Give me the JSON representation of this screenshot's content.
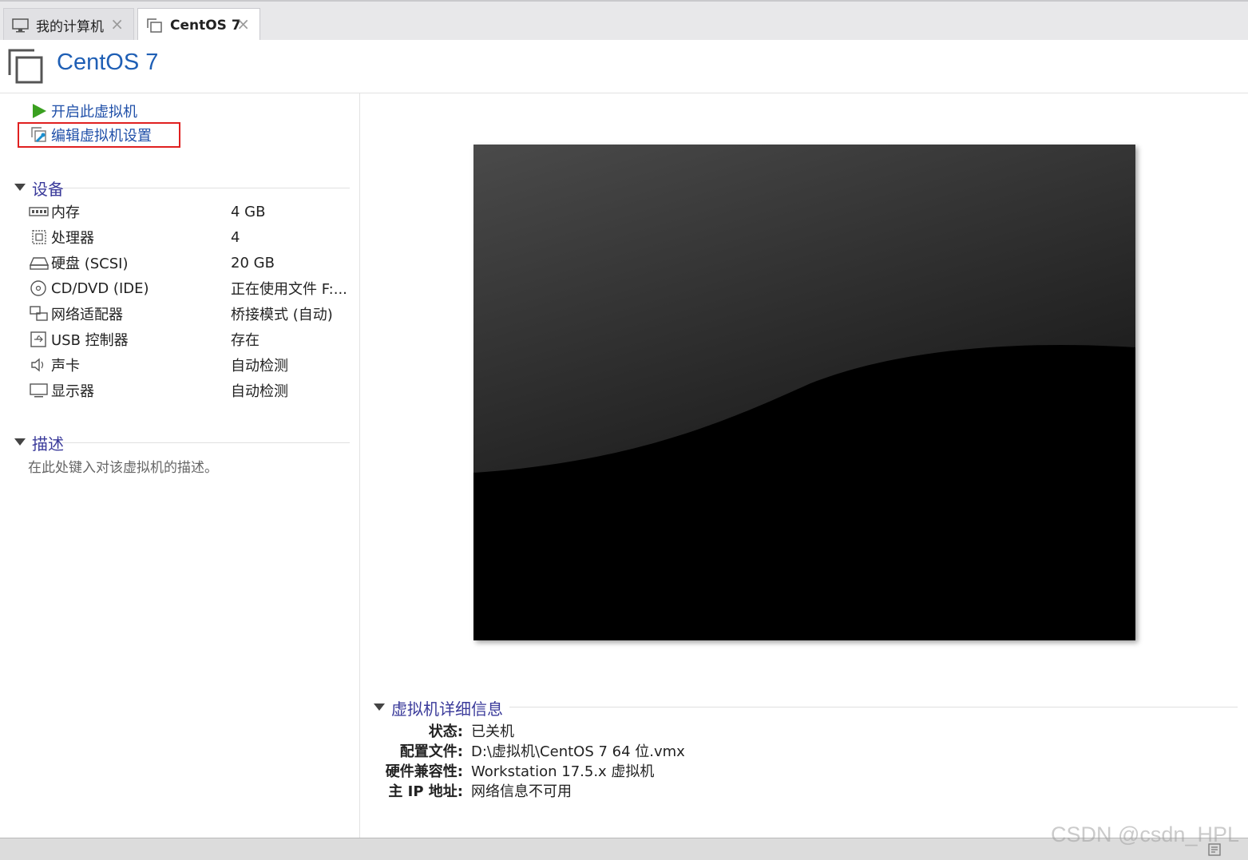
{
  "tabs": [
    {
      "label": "我的计算机",
      "icon": "monitor-icon",
      "close": "×"
    },
    {
      "label": "CentOS 7",
      "icon": "vm-icon",
      "close": "×"
    }
  ],
  "header": {
    "title": "CentOS 7",
    "icon": "vm-icon"
  },
  "actions": {
    "power_on": "开启此虚拟机",
    "edit_settings": "编辑虚拟机设置"
  },
  "devices": {
    "title": "设备",
    "items": [
      {
        "name": "内存",
        "value": "4 GB",
        "icon": "memory-icon"
      },
      {
        "name": "处理器",
        "value": "4",
        "icon": "cpu-icon"
      },
      {
        "name": "硬盘 (SCSI)",
        "value": "20 GB",
        "icon": "harddisk-icon"
      },
      {
        "name": "CD/DVD (IDE)",
        "value": "正在使用文件 F:...",
        "icon": "cdrom-icon"
      },
      {
        "name": "网络适配器",
        "value": "桥接模式 (自动)",
        "icon": "network-icon"
      },
      {
        "name": "USB 控制器",
        "value": "存在",
        "icon": "usb-icon"
      },
      {
        "name": "声卡",
        "value": "自动检测",
        "icon": "speaker-icon"
      },
      {
        "name": "显示器",
        "value": "自动检测",
        "icon": "display-icon"
      }
    ]
  },
  "description": {
    "title": "描述",
    "placeholder": "在此处键入对该虚拟机的描述。"
  },
  "details": {
    "title": "虚拟机详细信息",
    "rows": [
      {
        "key": "状态:",
        "value": "已关机"
      },
      {
        "key": "配置文件:",
        "value": "D:\\虚拟机\\CentOS 7 64 位.vmx"
      },
      {
        "key": "硬件兼容性:",
        "value": "Workstation 17.5.x 虚拟机"
      },
      {
        "key": "主 IP 地址:",
        "value": "网络信息不可用"
      }
    ]
  },
  "watermark": "CSDN @csdn_HPL",
  "colors": {
    "accent": "#1f5fb5",
    "section": "#3a3a9a",
    "highlight": "#e02020",
    "play": "#3aa020"
  }
}
